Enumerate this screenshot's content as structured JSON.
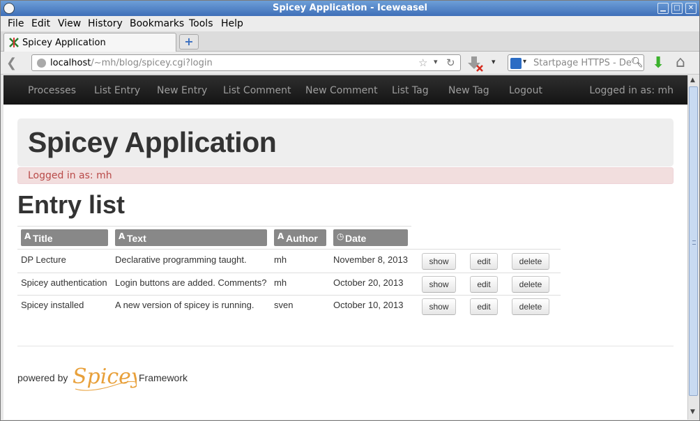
{
  "window": {
    "title": "Spicey Application - Iceweasel"
  },
  "menu": {
    "items": [
      "File",
      "Edit",
      "View",
      "History",
      "Bookmarks",
      "Tools",
      "Help"
    ]
  },
  "tab": {
    "label": "Spicey Application"
  },
  "address": {
    "host": "localhost",
    "path": "/~mh/blog/spicey.cgi?login"
  },
  "search": {
    "placeholder": "Startpage HTTPS - De"
  },
  "nav": {
    "links": [
      "Processes",
      "List Entry",
      "New Entry",
      "List Comment",
      "New Comment",
      "List Tag",
      "New Tag",
      "Logout"
    ],
    "logged_in": "Logged in as: mh"
  },
  "hero": {
    "title": "Spicey Application"
  },
  "alert": {
    "message": "Logged in as: mh"
  },
  "page": {
    "title": "Entry list"
  },
  "table": {
    "columns": [
      "Title",
      "Text",
      "Author",
      "Date"
    ],
    "rows": [
      {
        "title": "DP Lecture",
        "text": "Declarative programming taught.",
        "author": "mh",
        "date": "November 8, 2013"
      },
      {
        "title": "Spicey authentication",
        "text": "Login buttons are added. Comments?",
        "author": "mh",
        "date": "October 20, 2013"
      },
      {
        "title": "Spicey installed",
        "text": "A new version of spicey is running.",
        "author": "sven",
        "date": "October 10, 2013"
      }
    ],
    "actions": [
      "show",
      "edit",
      "delete"
    ]
  },
  "footer": {
    "powered_by": "powered by",
    "logo": "Spicey",
    "framework": "Framework"
  },
  "colors": {
    "titlebar": "#3f6fb8",
    "navbar": "#1b1b1b",
    "hero_bg": "#eeeeee",
    "alert_bg": "#f2dede",
    "alert_text": "#b94a48",
    "table_header": "#888888",
    "logo": "#e8a03a"
  }
}
